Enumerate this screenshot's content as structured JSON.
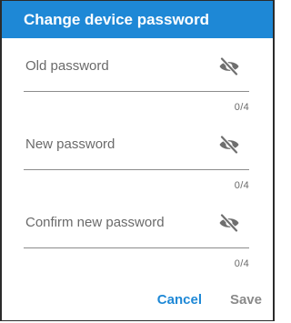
{
  "dialog": {
    "title": "Change device password"
  },
  "fields": [
    {
      "label": "Old password",
      "value": "",
      "counter": "0/4",
      "icon": "eye-off-icon"
    },
    {
      "label": "New password",
      "value": "",
      "counter": "0/4",
      "icon": "eye-off-icon"
    },
    {
      "label": "Confirm new password",
      "value": "",
      "counter": "0/4",
      "icon": "eye-off-icon"
    }
  ],
  "actions": {
    "cancel_label": "Cancel",
    "save_label": "Save"
  },
  "colors": {
    "accent": "#1e88d6",
    "header_text": "#ffffff",
    "label_text": "#6a6a6a",
    "disabled_text": "#8a8a8a"
  }
}
